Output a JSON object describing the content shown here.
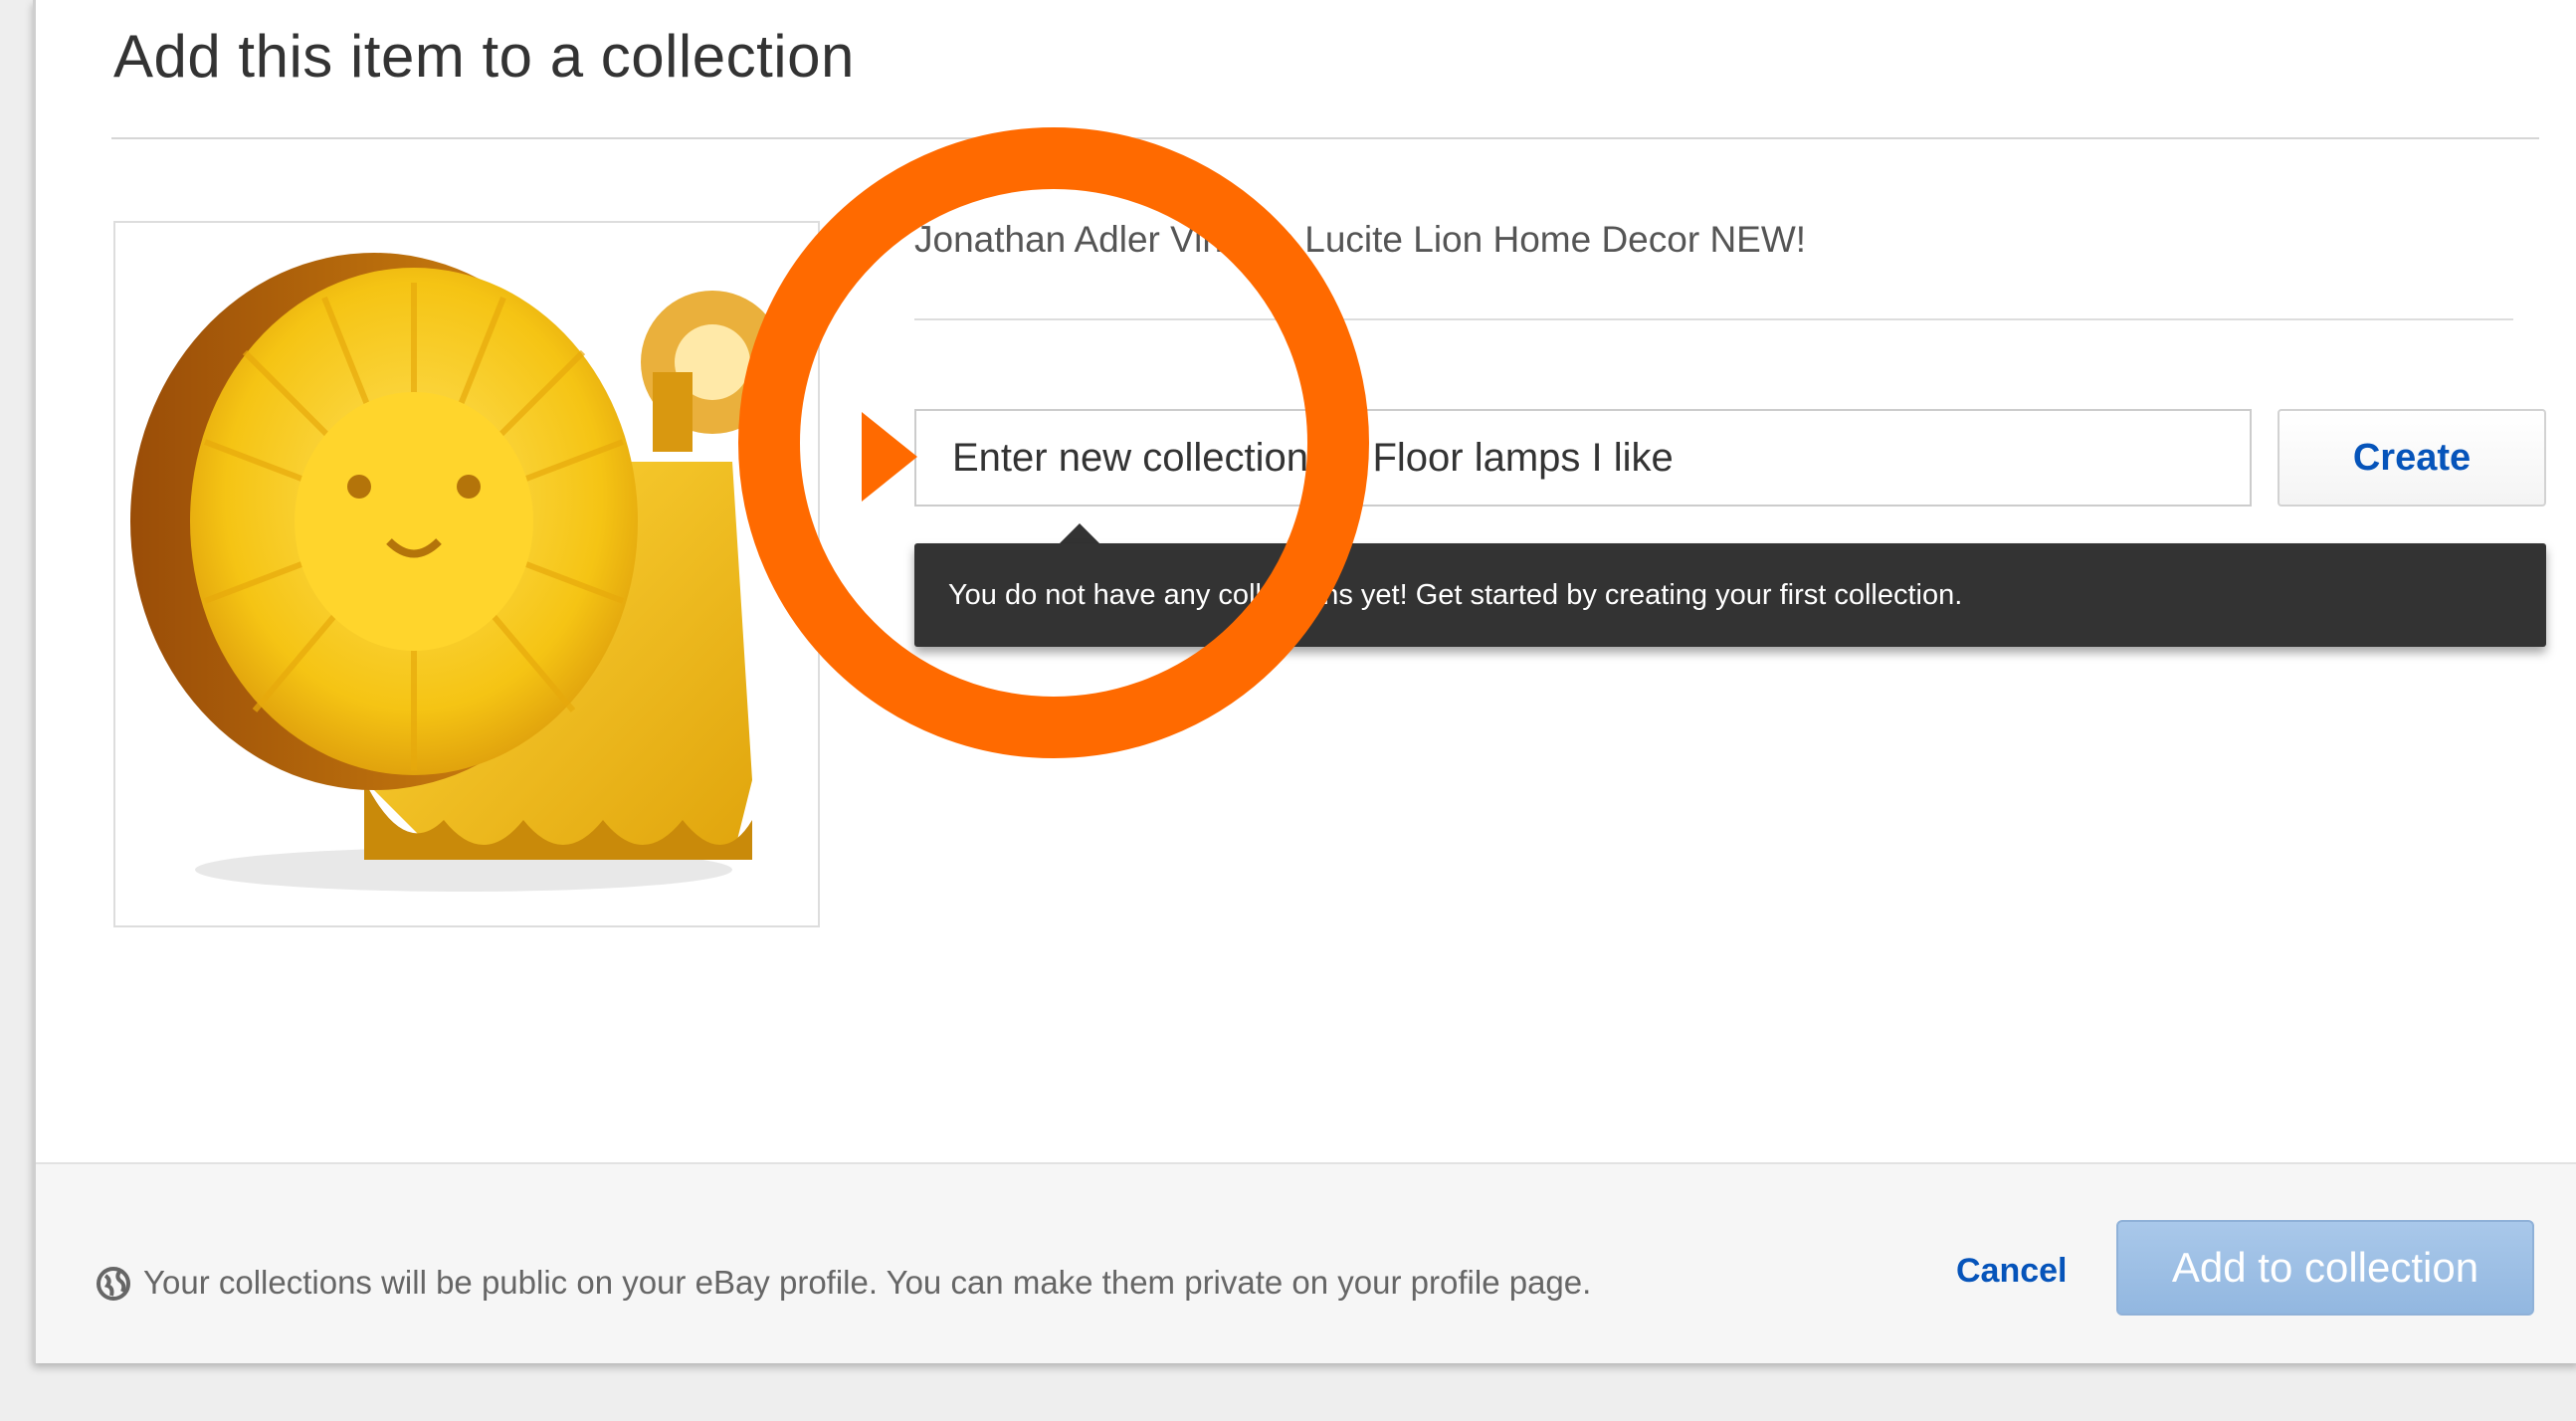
{
  "dialog": {
    "title": "Add this item to a collection"
  },
  "item": {
    "title": "Jonathan Adler Vintage Lucite Lion Home Decor NEW!",
    "image_icon": "lucite-lion-image"
  },
  "new_collection": {
    "value": "",
    "placeholder": "Enter new collection ie. Floor lamps I like",
    "create_label": "Create"
  },
  "tooltip": {
    "message": "You do not have any collections yet! Get started by creating your first collection."
  },
  "footer": {
    "note_icon": "globe-icon",
    "note": "Your collections will be public on your eBay profile. You can make them private on your profile page.",
    "cancel_label": "Cancel",
    "add_label": "Add to collection"
  },
  "colors": {
    "link_blue": "#0654ba",
    "highlight_orange": "#ff6a00",
    "tooltip_bg": "#333333",
    "primary_disabled": "#a9c8ea"
  }
}
